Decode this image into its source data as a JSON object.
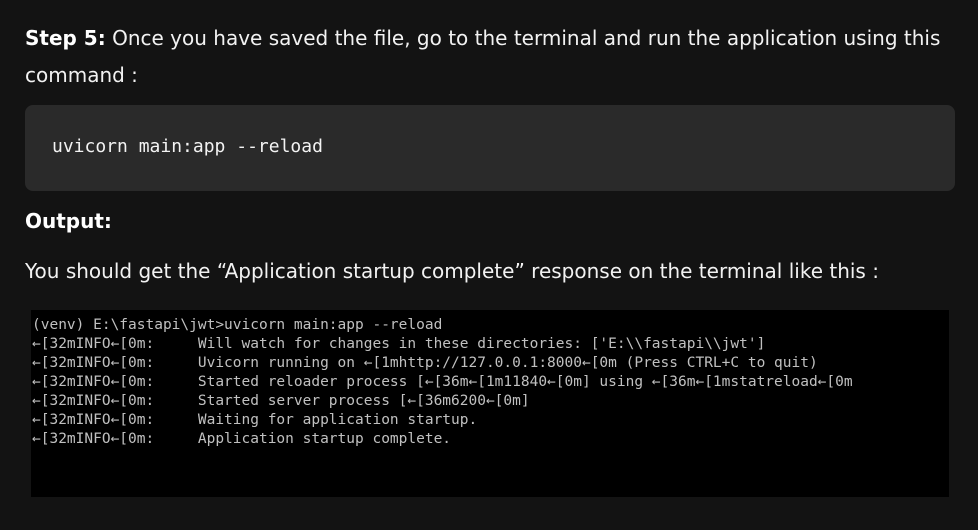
{
  "step": {
    "label": "Step 5:",
    "text": " Once you have saved the file, go to the terminal and run the application using this command :"
  },
  "code": {
    "command": "uvicorn main:app --reload"
  },
  "output_heading": "Output:",
  "description": "You should get the “Application startup complete” response on the terminal like this :",
  "terminal": {
    "lines": [
      "(venv) E:\\fastapi\\jwt>uvicorn main:app --reload",
      "←[32mINFO←[0m:     Will watch for changes in these directories: ['E:\\\\fastapi\\\\jwt']",
      "←[32mINFO←[0m:     Uvicorn running on ←[1mhttp://127.0.0.1:8000←[0m (Press CTRL+C to quit)",
      "←[32mINFO←[0m:     Started reloader process [←[36m←[1m11840←[0m] using ←[36m←[1mstatreload←[0m",
      "←[32mINFO←[0m:     Started server process [←[36m6200←[0m]",
      "←[32mINFO←[0m:     Waiting for application startup.",
      "←[32mINFO←[0m:     Application startup complete."
    ]
  }
}
